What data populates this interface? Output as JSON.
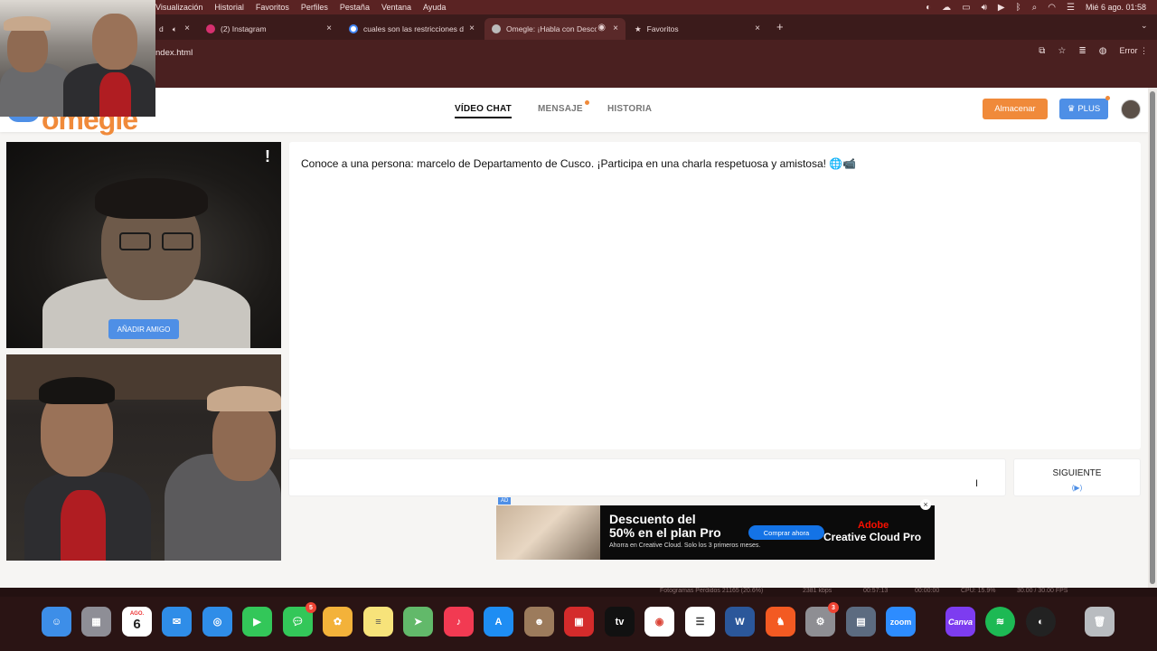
{
  "menubar": {
    "items": [
      "Visualización",
      "Historial",
      "Favoritos",
      "Perfiles",
      "Pestaña",
      "Ventana",
      "Ayuda"
    ],
    "datetime": "Mié 6 ago. 01:58"
  },
  "tabs": [
    {
      "label": "d",
      "icon": "speaker-icon"
    },
    {
      "label": "(2) Instagram",
      "icon": "instagram-icon"
    },
    {
      "label": "cuales son las restricciones d",
      "icon": "google-icon"
    },
    {
      "label": "Omegle: ¡Habla con Desco",
      "icon": "globe-icon",
      "active": true
    },
    {
      "label": "Favoritos",
      "icon": "star-icon"
    }
  ],
  "address": {
    "url": "ndex.html",
    "error_label": "Error"
  },
  "nav": {
    "video_chat": "VÍDEO CHAT",
    "message": "MENSAJE",
    "history": "HISTORIA",
    "store_button": "Almacenar",
    "plus_button": "PLUS"
  },
  "video": {
    "report_icon": "!",
    "add_friend": "AÑADIR AMIGO"
  },
  "chat": {
    "intro": "Conoce a una persona: marcelo de Departamento de Cusco. ¡Participa en una charla respetuosa y amistosa! 🌐📹"
  },
  "next": {
    "label": "SIGUIENTE",
    "sub": "(▶)"
  },
  "ad": {
    "tag": "AD",
    "headline1": "Descuento del",
    "headline2": "50% en el plan Pro",
    "subtext": "Ahorra en Creative Cloud. Solo los 3 primeros meses.",
    "button": "Comprar ahora",
    "brand1": "Adobe",
    "brand2": "Creative Cloud Pro",
    "close": "×"
  },
  "statusbar": {
    "frames": "Fotogramas Perdidos 21165 (20.6%)",
    "kbps": "2381 kbps",
    "time": "00:57:13",
    "zero": "00:00:00",
    "cpu": "CPU: 15.9%",
    "fps": "30.00 / 30.00 FPS"
  },
  "dock": {
    "calendar_month": "AGO.",
    "calendar_day": "6",
    "messages_badge": "5",
    "settings_badge": "3",
    "zoom_label": "zoom",
    "canva_label": "Canva",
    "word_label": "W",
    "tv_label": "tv"
  },
  "colors": {
    "accent_orange": "#f08a3a",
    "accent_blue": "#4e8fe6",
    "browser_frame": "#4a2020"
  }
}
